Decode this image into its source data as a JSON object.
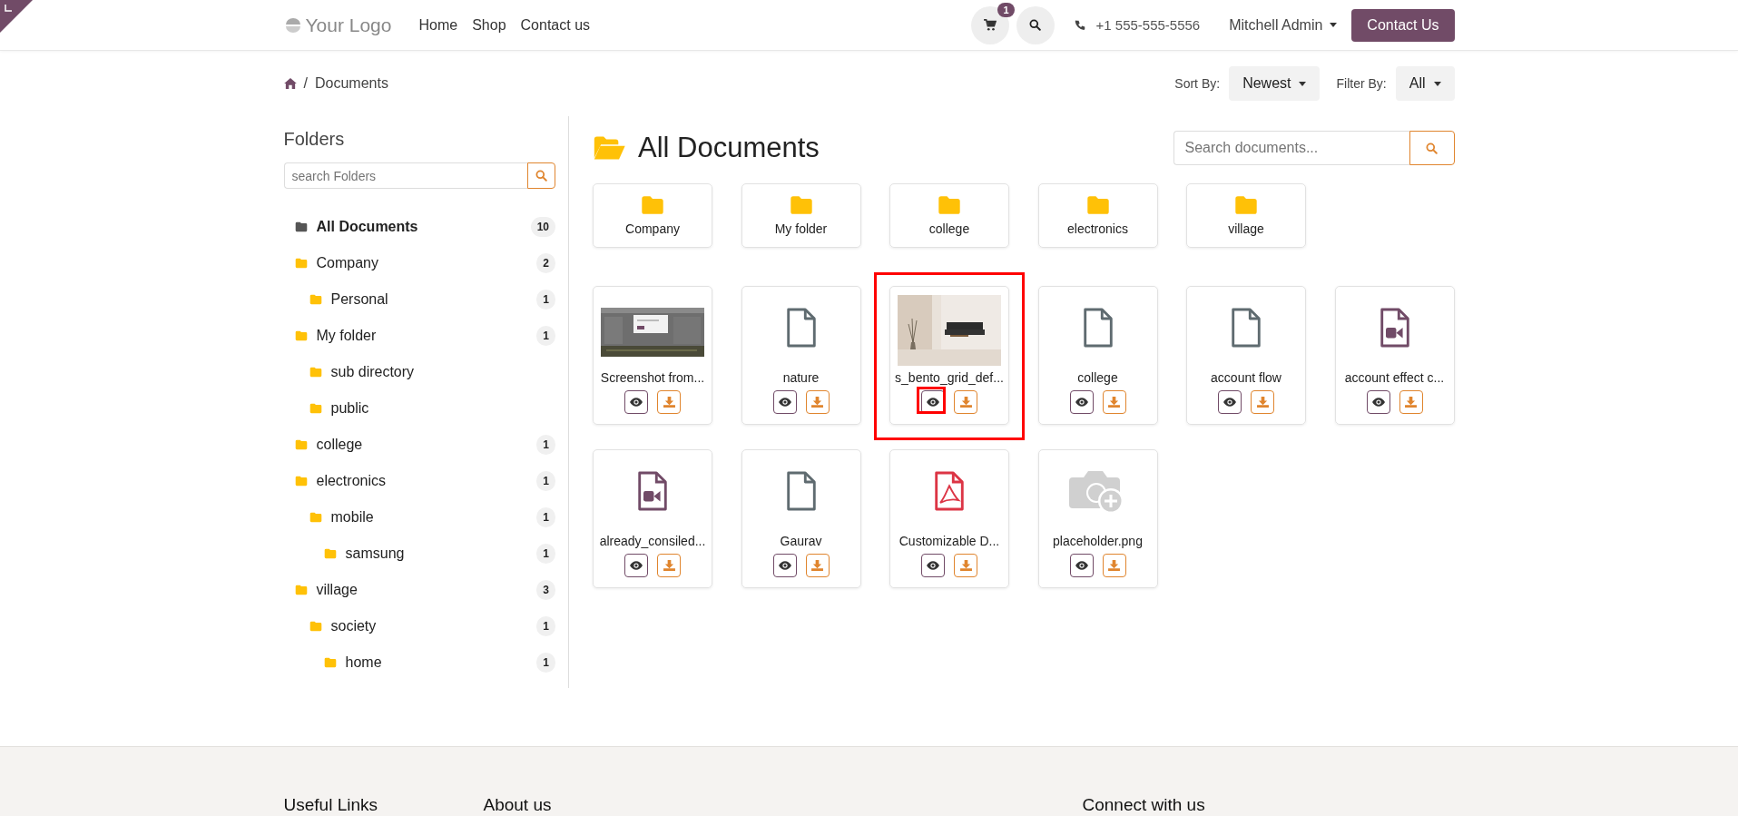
{
  "header": {
    "logo": "Your Logo",
    "nav": [
      {
        "label": "Home"
      },
      {
        "label": "Shop"
      },
      {
        "label": "Contact us"
      }
    ],
    "cart_count": "1",
    "phone": "+1 555-555-5556",
    "user": "Mitchell Admin",
    "cta": "Contact Us"
  },
  "breadcrumb": {
    "separator": "/",
    "current": "Documents"
  },
  "sort": {
    "label": "Sort By:",
    "value": "Newest"
  },
  "filter": {
    "label": "Filter By:",
    "value": "All"
  },
  "sidebar": {
    "title": "Folders",
    "search": {
      "placeholder": "search Folders"
    },
    "items": [
      {
        "label": "All Documents",
        "count": "10",
        "selected": true
      },
      {
        "label": "Company",
        "count": "2",
        "selected": false,
        "children": [
          {
            "label": "Personal",
            "count": "1",
            "selected": false
          }
        ]
      },
      {
        "label": "My folder",
        "count": "1",
        "selected": false,
        "children": [
          {
            "label": "sub directory",
            "selected": false
          },
          {
            "label": "public",
            "selected": false
          }
        ]
      },
      {
        "label": "college",
        "count": "1",
        "selected": false
      },
      {
        "label": "electronics",
        "count": "1",
        "selected": false,
        "children": [
          {
            "label": "mobile",
            "count": "1",
            "selected": false,
            "children": [
              {
                "label": "samsung",
                "count": "1",
                "selected": false
              }
            ]
          }
        ]
      },
      {
        "label": "village",
        "count": "3",
        "selected": false,
        "children": [
          {
            "label": "society",
            "count": "1",
            "selected": false,
            "children": [
              {
                "label": "home",
                "count": "1",
                "selected": false
              }
            ]
          }
        ]
      }
    ]
  },
  "main": {
    "title": "All Documents",
    "search": {
      "placeholder": "Search documents..."
    },
    "folders": [
      {
        "label": "Company"
      },
      {
        "label": "My folder"
      },
      {
        "label": "college"
      },
      {
        "label": "electronics"
      },
      {
        "label": "village"
      }
    ],
    "documents": [
      {
        "name": "Screenshot from...",
        "kind": "screenshot",
        "highlighted": false,
        "view_highlighted": false
      },
      {
        "name": "nature",
        "kind": "file",
        "highlighted": false,
        "view_highlighted": false
      },
      {
        "name": "s_bento_grid_def...",
        "highlighted": true,
        "view_highlighted": true
      },
      {
        "name": "college",
        "kind": "file",
        "highlighted": false,
        "view_highlighted": false
      },
      {
        "name": "account flow",
        "kind": "file",
        "highlighted": false,
        "view_highlighted": false
      },
      {
        "name": "account effect c...",
        "kind": "video",
        "highlighted": false,
        "view_highlighted": false
      },
      {
        "name": "already_consiled...",
        "kind": "video",
        "highlighted": false,
        "view_highlighted": false
      },
      {
        "name": "Gaurav",
        "kind": "file",
        "highlighted": false,
        "view_highlighted": false
      },
      {
        "name": "Customizable D...",
        "kind": "pdf",
        "highlighted": false,
        "view_highlighted": false
      },
      {
        "name": "placeholder.png",
        "kind": "placeholder",
        "highlighted": false,
        "view_highlighted": false
      }
    ]
  },
  "footer": {
    "headings": [
      {
        "label": "Useful Links"
      },
      {
        "label": "About us"
      },
      {
        "label": "Connect with us"
      }
    ]
  }
}
